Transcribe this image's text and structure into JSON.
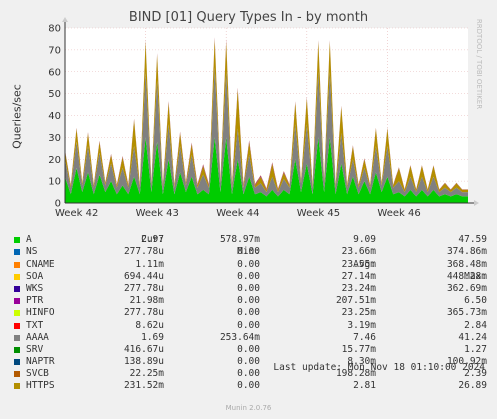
{
  "title": "BIND [01] Query Types In - by month",
  "ylabel": "Queries/sec",
  "side_label": "RRDTOOL / TOBI OETIKER",
  "legend_headers": {
    "cur": "Cur:",
    "min": "Min:",
    "avg": "Avg:",
    "max": "Max:"
  },
  "legend": [
    {
      "name": "A",
      "color": "#00cc00",
      "cur": "2.97",
      "min": "578.97m",
      "avg": "9.09",
      "max": "47.59"
    },
    {
      "name": "NS",
      "color": "#0066b3",
      "cur": "277.78u",
      "min": "0.00",
      "avg": "23.66m",
      "max": "374.86m"
    },
    {
      "name": "CNAME",
      "color": "#ff8000",
      "cur": "1.11m",
      "min": "0.00",
      "avg": "23.55m",
      "max": "368.48m"
    },
    {
      "name": "SOA",
      "color": "#ffcc00",
      "cur": "694.44u",
      "min": "0.00",
      "avg": "27.14m",
      "max": "448.28m"
    },
    {
      "name": "WKS",
      "color": "#330099",
      "cur": "277.78u",
      "min": "0.00",
      "avg": "23.24m",
      "max": "362.69m"
    },
    {
      "name": "PTR",
      "color": "#990099",
      "cur": "21.98m",
      "min": "0.00",
      "avg": "207.51m",
      "max": "6.50"
    },
    {
      "name": "HINFO",
      "color": "#ccff00",
      "cur": "277.78u",
      "min": "0.00",
      "avg": "23.25m",
      "max": "365.73m"
    },
    {
      "name": "TXT",
      "color": "#ff0000",
      "cur": "8.62u",
      "min": "0.00",
      "avg": "3.19m",
      "max": "2.84"
    },
    {
      "name": "AAAA",
      "color": "#808080",
      "cur": "1.69",
      "min": "253.64m",
      "avg": "7.46",
      "max": "41.24"
    },
    {
      "name": "SRV",
      "color": "#008f00",
      "cur": "416.67u",
      "min": "0.00",
      "avg": "15.77m",
      "max": "1.27"
    },
    {
      "name": "NAPTR",
      "color": "#00487d",
      "cur": "138.89u",
      "min": "0.00",
      "avg": "8.30m",
      "max": "100.92m"
    },
    {
      "name": "SVCB",
      "color": "#b35a00",
      "cur": "22.25m",
      "min": "0.00",
      "avg": "198.28m",
      "max": "2.39"
    },
    {
      "name": "HTTPS",
      "color": "#b38f00",
      "cur": "231.52m",
      "min": "0.00",
      "avg": "2.81",
      "max": "26.89"
    }
  ],
  "last_update": "Last update: Mon Nov 18 01:10:00 2024",
  "munin": "Munin 2.0.76",
  "chart_data": {
    "type": "area",
    "title": "BIND [01] Query Types In - by month",
    "ylabel": "Queries/sec",
    "ylim": [
      0,
      80
    ],
    "yticks": [
      0,
      10,
      20,
      30,
      40,
      50,
      60,
      70,
      80
    ],
    "xticks": [
      "Week 42",
      "Week 43",
      "Week 44",
      "Week 45",
      "Week 46"
    ],
    "x_range_days": [
      0,
      35
    ],
    "grid": true,
    "stacked": true,
    "series": [
      {
        "name": "A",
        "color": "#00cc00",
        "x": [
          0,
          0.5,
          1,
          1.5,
          2,
          2.5,
          3,
          3.5,
          4,
          4.5,
          5,
          5.5,
          6,
          6.5,
          7,
          7.5,
          8,
          8.5,
          9,
          9.5,
          10,
          10.5,
          11,
          11.5,
          12,
          12.5,
          13,
          13.5,
          14,
          14.5,
          15,
          15.5,
          16,
          16.5,
          17,
          17.5,
          18,
          18.5,
          19,
          19.5,
          20,
          20.5,
          21,
          21.5,
          22,
          22.5,
          23,
          23.5,
          24,
          24.5,
          25,
          25.5,
          26,
          26.5,
          27,
          27.5,
          28,
          28.5,
          29,
          29.5,
          30,
          30.5,
          31,
          31.5,
          32,
          32.5,
          33,
          33.5,
          34,
          34.5
        ],
        "values": [
          12,
          4,
          16,
          5,
          14,
          4,
          13,
          5,
          10,
          4,
          8,
          4,
          12,
          4,
          30,
          5,
          28,
          4,
          20,
          4,
          14,
          5,
          12,
          4,
          6,
          4,
          30,
          5,
          30,
          4,
          20,
          4,
          12,
          4,
          5,
          3,
          6,
          3,
          6,
          4,
          20,
          5,
          18,
          4,
          30,
          5,
          30,
          4,
          18,
          4,
          12,
          4,
          10,
          4,
          14,
          5,
          12,
          4,
          5,
          3,
          6,
          3,
          6,
          3,
          6,
          3,
          4,
          3,
          4,
          3
        ]
      },
      {
        "name": "AAAA",
        "color": "#808080",
        "x": [
          0,
          0.5,
          1,
          1.5,
          2,
          2.5,
          3,
          3.5,
          4,
          4.5,
          5,
          5.5,
          6,
          6.5,
          7,
          7.5,
          8,
          8.5,
          9,
          9.5,
          10,
          10.5,
          11,
          11.5,
          12,
          12.5,
          13,
          13.5,
          14,
          14.5,
          15,
          15.5,
          16,
          16.5,
          17,
          17.5,
          18,
          18.5,
          19,
          19.5,
          20,
          20.5,
          21,
          21.5,
          22,
          22.5,
          23,
          23.5,
          24,
          24.5,
          25,
          25.5,
          26,
          26.5,
          27,
          27.5,
          28,
          28.5,
          29,
          29.5,
          30,
          30.5,
          31,
          31.5,
          32,
          32.5,
          33,
          33.5,
          34,
          34.5
        ],
        "values": [
          8,
          3,
          12,
          3,
          12,
          3,
          10,
          3,
          8,
          3,
          8,
          3,
          14,
          3,
          30,
          3,
          28,
          3,
          16,
          3,
          12,
          3,
          10,
          3,
          7,
          3,
          32,
          4,
          30,
          3,
          14,
          3,
          10,
          3,
          4,
          2,
          6,
          2,
          5,
          3,
          16,
          4,
          18,
          3,
          30,
          4,
          30,
          3,
          14,
          3,
          8,
          3,
          6,
          3,
          12,
          3,
          14,
          3,
          5,
          2,
          6,
          2,
          6,
          2,
          6,
          2,
          3,
          2,
          3,
          2
        ]
      },
      {
        "name": "HTTPS",
        "color": "#b38f00",
        "x": [
          0,
          0.5,
          1,
          1.5,
          2,
          2.5,
          3,
          3.5,
          4,
          4.5,
          5,
          5.5,
          6,
          6.5,
          7,
          7.5,
          8,
          8.5,
          9,
          9.5,
          10,
          10.5,
          11,
          11.5,
          12,
          12.5,
          13,
          13.5,
          14,
          14.5,
          15,
          15.5,
          16,
          16.5,
          17,
          17.5,
          18,
          18.5,
          19,
          19.5,
          20,
          20.5,
          21,
          21.5,
          22,
          22.5,
          23,
          23.5,
          24,
          24.5,
          25,
          25.5,
          26,
          26.5,
          27,
          27.5,
          28,
          28.5,
          29,
          29.5,
          30,
          30.5,
          31,
          31.5,
          32,
          32.5,
          33,
          33.5,
          34,
          34.5
        ],
        "values": [
          4,
          1,
          6,
          1,
          6,
          1,
          5,
          1,
          4,
          1,
          5,
          1,
          12,
          1,
          14,
          1,
          12,
          1,
          10,
          1,
          6,
          1,
          5,
          1,
          4,
          1,
          13,
          1,
          14,
          1,
          18,
          1,
          6,
          1,
          3,
          1,
          6,
          1,
          3,
          1,
          10,
          1,
          12,
          1,
          14,
          1,
          14,
          1,
          12,
          1,
          6,
          1,
          4,
          1,
          8,
          1,
          8,
          1,
          6,
          1,
          5,
          1,
          5,
          1,
          5,
          1,
          2,
          1,
          2,
          1
        ]
      },
      {
        "name": "PTR",
        "color": "#990099",
        "x": [
          0,
          7,
          14,
          21,
          28,
          34.5
        ],
        "values": [
          0.2,
          0.3,
          0.5,
          0.3,
          0.2,
          0.1
        ]
      },
      {
        "name": "SVCB",
        "color": "#b35a00",
        "x": [
          0,
          7,
          14,
          21,
          28,
          34.5
        ],
        "values": [
          0.2,
          0.2,
          0.3,
          0.2,
          0.2,
          0.1
        ]
      }
    ]
  }
}
